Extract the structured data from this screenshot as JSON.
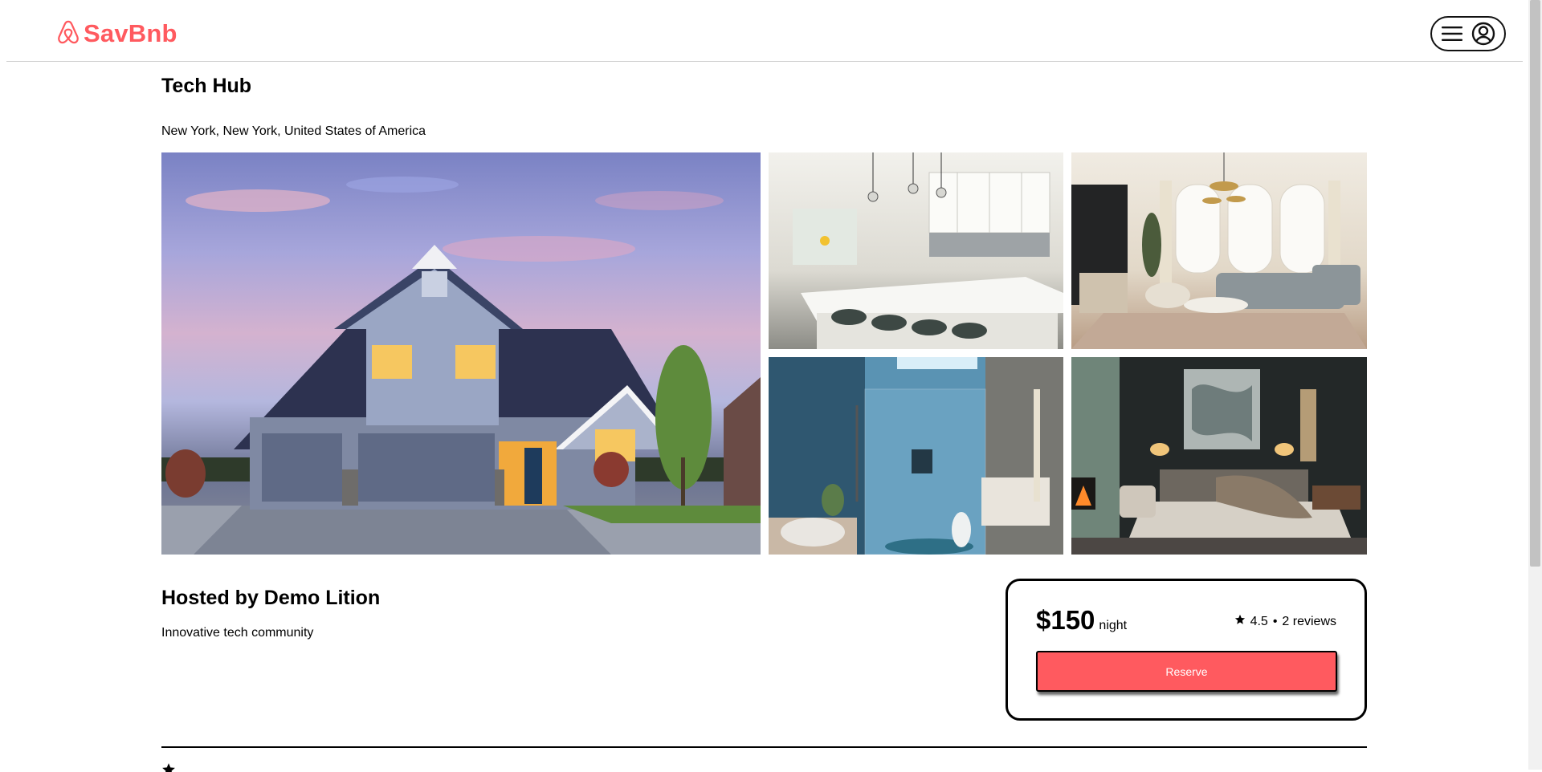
{
  "brand": {
    "name": "SavBnb",
    "color": "#ff5a5f",
    "logo_icon": "airbnb-logo-icon"
  },
  "header": {
    "menu_icon": "hamburger-icon",
    "profile_icon": "user-circle-icon"
  },
  "listing": {
    "title": "Tech Hub",
    "location": "New York, New York, United States of America",
    "host_heading": "Hosted by Demo Lition",
    "description": "Innovative tech community"
  },
  "gallery": [
    {
      "name": "house-exterior-photo"
    },
    {
      "name": "kitchen-photo"
    },
    {
      "name": "living-room-photo"
    },
    {
      "name": "bathroom-photo"
    },
    {
      "name": "bedroom-photo"
    }
  ],
  "booking": {
    "price": "$150",
    "price_unit": "night",
    "rating": "4.5",
    "separator": "•",
    "reviews": "2 reviews",
    "reserve_label": "Reserve",
    "reserve_color": "#ff5a5f"
  }
}
